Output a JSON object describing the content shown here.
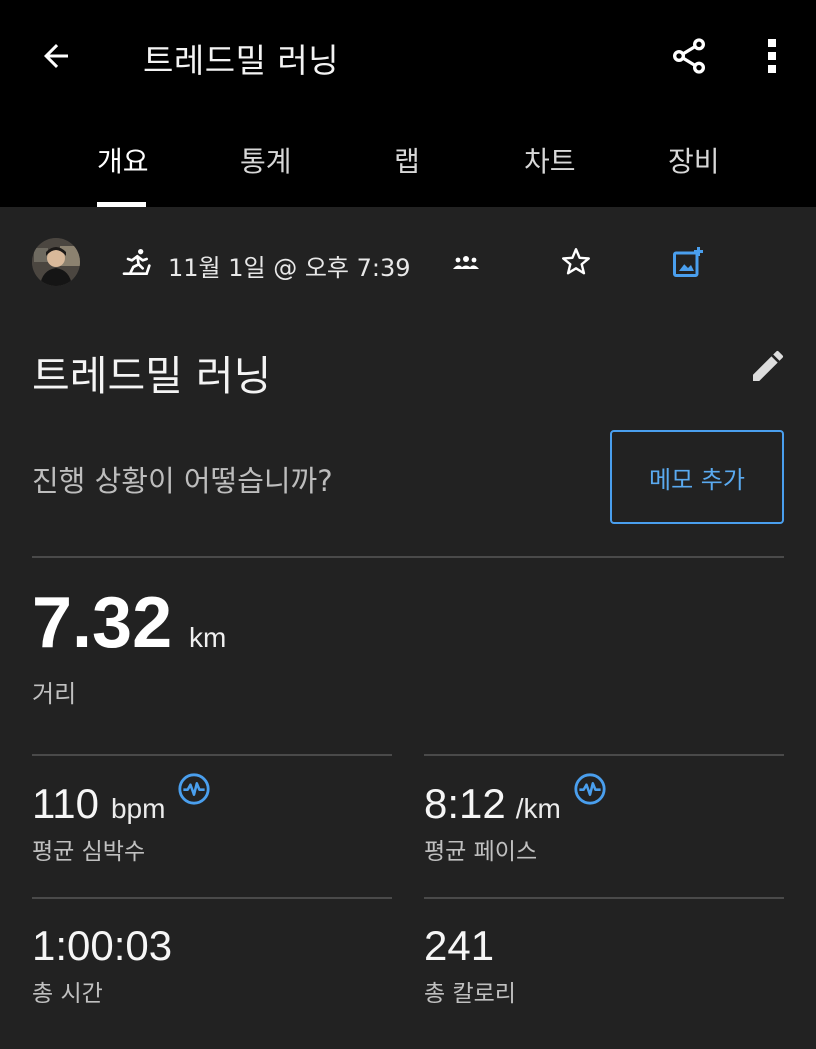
{
  "header": {
    "title": "트레드밀 러닝",
    "back_icon": "back-arrow-icon",
    "share_icon": "share-icon",
    "more_icon": "more-vert-icon"
  },
  "tabs": [
    {
      "label": "개요",
      "active": true
    },
    {
      "label": "통계",
      "active": false
    },
    {
      "label": "랩",
      "active": false
    },
    {
      "label": "차트",
      "active": false
    },
    {
      "label": "장비",
      "active": false
    }
  ],
  "meta": {
    "datetime": "11월 1일 @ 오후 7:39",
    "activity_icon": "treadmill-run-icon",
    "privacy_icon": "group-icon",
    "favorite_icon": "star-outline-icon",
    "photo_icon": "add-photo-icon"
  },
  "activity": {
    "title": "트레드밀 러닝",
    "prompt": "진행 상황이 어떻습니까?",
    "memo_button": "메모 추가"
  },
  "distance": {
    "value": "7.32",
    "unit": "km",
    "label": "거리"
  },
  "stats": {
    "heart_rate": {
      "value": "110",
      "unit": "bpm",
      "label": "평균 심박수"
    },
    "pace": {
      "value": "8:12",
      "unit": "/km",
      "label": "평균 페이스"
    },
    "time": {
      "value": "1:00:03",
      "label": "총 시간"
    },
    "calories": {
      "value": "241",
      "label": "총 칼로리"
    }
  },
  "colors": {
    "accent": "#4a9fee",
    "header_bg": "#000000",
    "content_bg": "#222222"
  }
}
